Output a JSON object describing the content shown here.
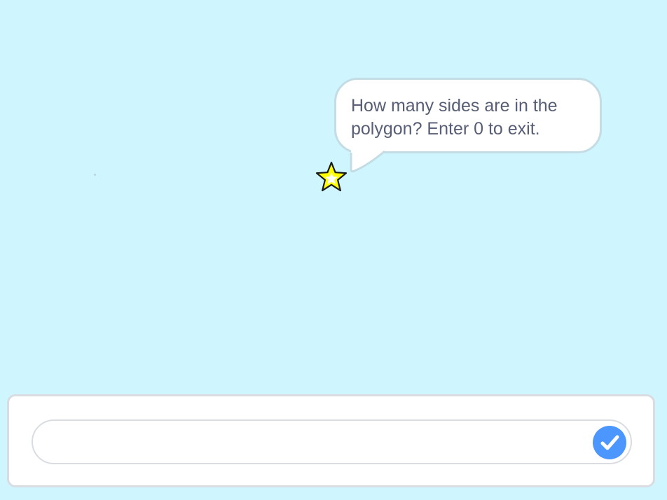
{
  "stage": {
    "background_color": "#cff5ff"
  },
  "speech_bubble": {
    "line1": "How many sides are in the",
    "line2": "polygon? Enter 0 to exit."
  },
  "sprite": {
    "icon": "star-icon",
    "fill_color": "#ffff00"
  },
  "ask_prompt": {
    "answer_value": "",
    "answer_placeholder": "",
    "submit_icon": "checkmark-icon",
    "submit_color": "#4c97ff"
  }
}
